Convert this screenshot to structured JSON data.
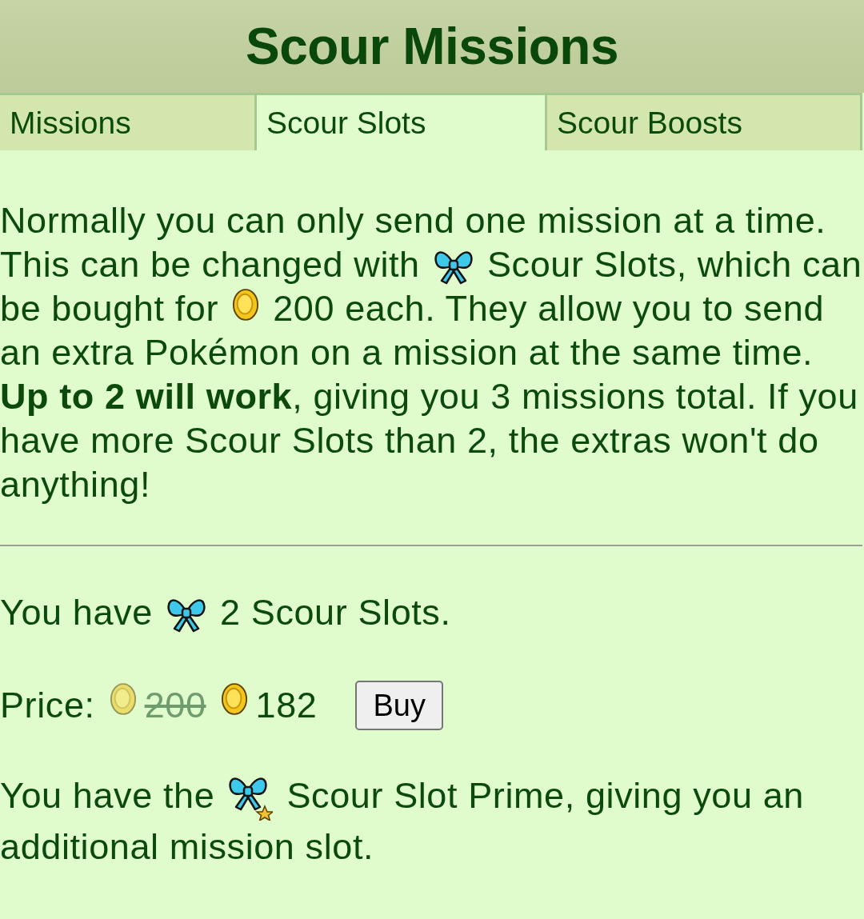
{
  "header": {
    "title": "Scour Missions"
  },
  "tabs": [
    {
      "label": "Missions",
      "selected": false
    },
    {
      "label": "Scour Slots",
      "selected": true
    },
    {
      "label": "Scour Boosts",
      "selected": false
    }
  ],
  "intro": [
    {
      "kind": "text",
      "text": "Normally you can only send one mission at a time. This can be changed with"
    },
    {
      "kind": "slot"
    },
    {
      "kind": "text",
      "text": "Scour Slots, which can be bought for"
    },
    {
      "kind": "coin"
    },
    {
      "kind": "text",
      "text": "200 each. They allow you to send an extra Pokémon on a mission at the same time. **Up to 2 will work**, giving you 3 missions total. If you have more Scour Slots than 2, the extras won't do anything!"
    }
  ],
  "owned": [
    {
      "kind": "text",
      "text": "You have"
    },
    {
      "kind": "slot"
    },
    {
      "kind": "text",
      "text": "2 Scour Slots."
    }
  ],
  "price": {
    "label": "Price:",
    "old_price": "200",
    "new_price": "182",
    "button": "Buy"
  },
  "prime": [
    {
      "kind": "text",
      "text": "You have the"
    },
    {
      "kind": "slot_prime"
    },
    {
      "kind": "text",
      "text": "Scour Slot Prime, giving you an additional mission slot."
    }
  ]
}
